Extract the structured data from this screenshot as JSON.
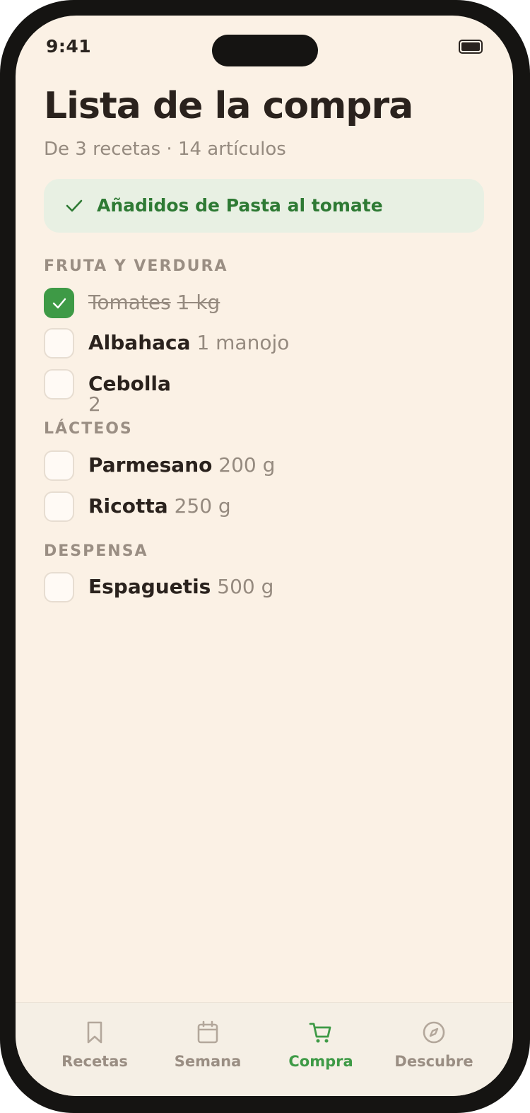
{
  "status_bar": {
    "time": "9:41"
  },
  "header": {
    "title": "Lista de la compra",
    "subtitle": "De 3 recetas · 14 artículos"
  },
  "toast": {
    "icon": "check-icon",
    "text": "Añadidos de Pasta al tomate"
  },
  "sections": [
    {
      "title": "FRUTA Y VERDURA",
      "items": [
        {
          "name": "Tomates",
          "qty": "1 kg",
          "checked": true
        },
        {
          "name": "Albahaca",
          "qty": "1 manojo",
          "checked": false
        },
        {
          "name": "Cebolla",
          "qty": "2",
          "checked": false
        }
      ]
    },
    {
      "title": "LÁCTEOS",
      "items": [
        {
          "name": "Parmesano",
          "qty": "200 g",
          "checked": false
        },
        {
          "name": "Ricotta",
          "qty": "250 g",
          "checked": false
        }
      ]
    },
    {
      "title": "DESPENSA",
      "items": [
        {
          "name": "Espaguetis",
          "qty": "500 g",
          "checked": false
        }
      ]
    }
  ],
  "tabs": [
    {
      "label": "Recetas",
      "icon": "bookmark-icon",
      "active": false
    },
    {
      "label": "Semana",
      "icon": "calendar-icon",
      "active": false
    },
    {
      "label": "Compra",
      "icon": "cart-icon",
      "active": true
    },
    {
      "label": "Descubre",
      "icon": "compass-icon",
      "active": false
    }
  ],
  "colors": {
    "background": "#fbf1e5",
    "accent": "#3e9a46",
    "text": "#2a221d",
    "muted": "#958a7f",
    "toast_bg": "#e8f0e3"
  }
}
